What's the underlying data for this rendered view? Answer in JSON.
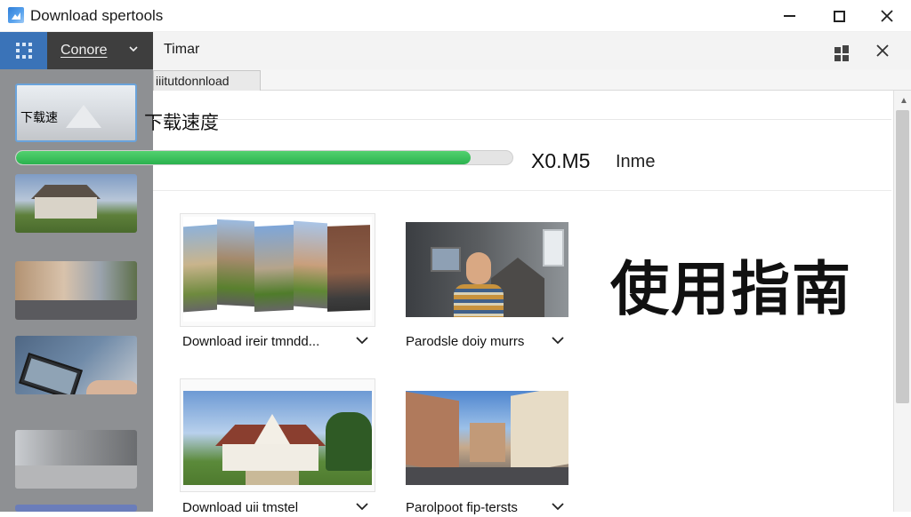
{
  "window": {
    "title": "Download spertools",
    "app_icon": "app-photo-icon",
    "minimize_icon": "minimize-icon",
    "maximize_icon": "maximize-icon",
    "close_icon": "close-icon"
  },
  "menubar": {
    "grid_icon": "grid-icon",
    "dropdown_label": "Conore",
    "dropdown_icon": "chevron-down-icon",
    "timar_label": "Timar",
    "extension_icon": "extensions-icon",
    "close_icon": "close-icon"
  },
  "sidebar": {
    "thumbnails": [
      {
        "label": "下载速",
        "selected": true
      },
      {
        "label": ""
      },
      {
        "label": ""
      },
      {
        "label": ""
      },
      {
        "label": ""
      },
      {
        "label": ""
      }
    ]
  },
  "tabs": {
    "active_label": "iiitutdonnload"
  },
  "main": {
    "speed_label": "下载速度",
    "progress": {
      "fraction": 0.915,
      "value_text": "X0.M5",
      "unit_text": "Inme"
    },
    "heading": "使用指南",
    "cards": [
      {
        "label": "Download ireir tmndd...",
        "chevron": "chevron-down-icon"
      },
      {
        "label": "Parodsle doiy murrs",
        "chevron": "chevron-down-icon"
      },
      {
        "label": "Download uii tmstel",
        "chevron": "chevron-down-icon"
      },
      {
        "label": "Parolpoot fip-tersts",
        "chevron": "chevron-down-icon"
      }
    ]
  },
  "colors": {
    "accent_blue": "#3a73b8",
    "menu_dark": "#3e3e3e",
    "progress_green": "#2bb24f",
    "sidebar_bg": "#8e9093"
  }
}
